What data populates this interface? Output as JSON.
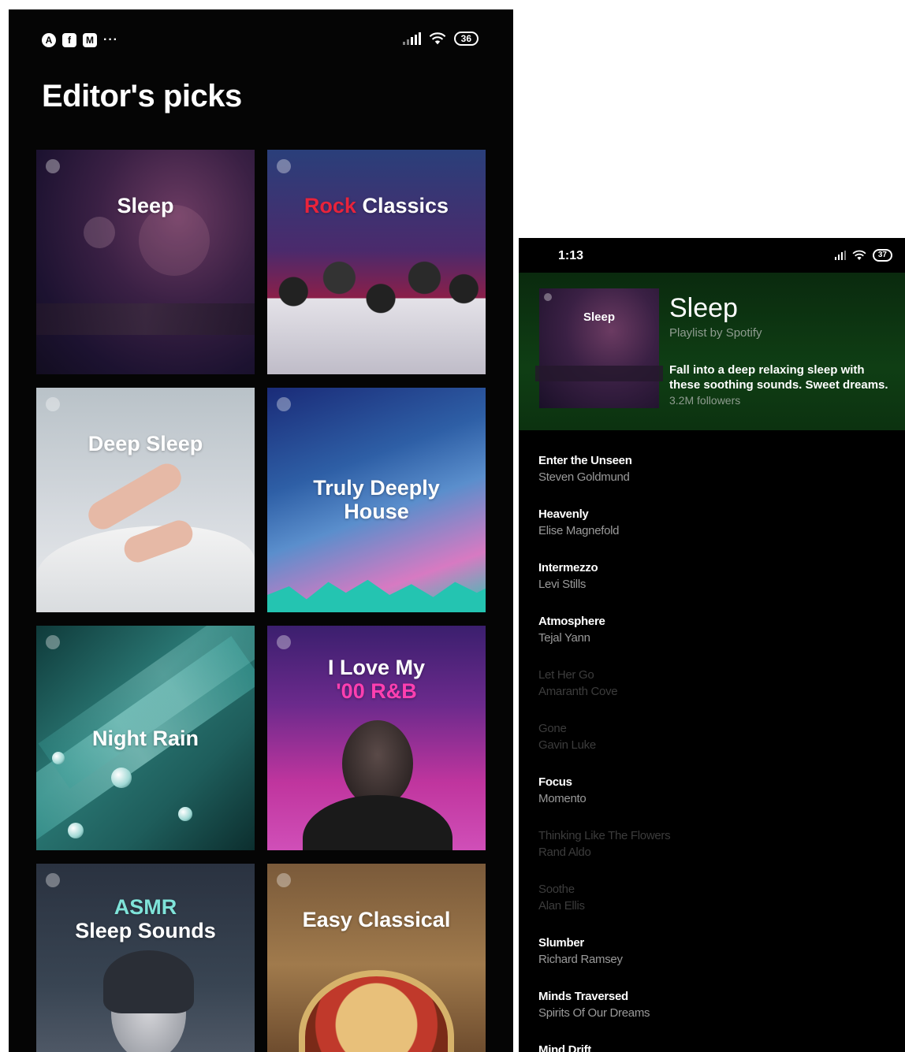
{
  "left_phone": {
    "status": {
      "battery": "36",
      "more": "···"
    },
    "title": "Editor's picks",
    "tiles": [
      {
        "title": "Sleep"
      },
      {
        "title_accent": "Rock",
        "title": "Classics",
        "accent_color": "#e8233b"
      },
      {
        "title": "Deep Sleep"
      },
      {
        "title": "Truly Deeply House"
      },
      {
        "title": "Night Rain"
      },
      {
        "title": "I Love My",
        "title_line2": "'00 R&B",
        "accent_color": "#ff3fb0"
      },
      {
        "title_accent": "ASMR",
        "title": "Sleep Sounds",
        "accent_color": "#7fe3d9"
      },
      {
        "title": "Easy Classical"
      }
    ]
  },
  "right_phone": {
    "status": {
      "time": "1:13",
      "battery": "37"
    },
    "playlist": {
      "cover_label": "Sleep",
      "title": "Sleep",
      "subtitle": "Playlist by Spotify",
      "description": "Fall into a deep relaxing sleep with these soothing sounds. Sweet dreams.",
      "followers": "3.2M followers",
      "header_color": "#0f3e14"
    },
    "tracks": [
      {
        "name": "Enter the Unseen",
        "artist": "Steven Goldmund",
        "dim": false
      },
      {
        "name": "Heavenly",
        "artist": "Elise Magnefold",
        "dim": false
      },
      {
        "name": "Intermezzo",
        "artist": "Levi Stills",
        "dim": false
      },
      {
        "name": "Atmosphere",
        "artist": "Tejal Yann",
        "dim": false
      },
      {
        "name": "Let Her Go",
        "artist": "Amaranth Cove",
        "dim": true
      },
      {
        "name": "Gone",
        "artist": "Gavin Luke",
        "dim": true
      },
      {
        "name": "Focus",
        "artist": "Momento",
        "dim": false
      },
      {
        "name": "Thinking Like The Flowers",
        "artist": "Rand Aldo",
        "dim": true
      },
      {
        "name": "Soothe",
        "artist": "Alan Ellis",
        "dim": true
      },
      {
        "name": "Slumber",
        "artist": "Richard Ramsey",
        "dim": false
      },
      {
        "name": "Minds Traversed",
        "artist": "Spirits Of Our Dreams",
        "dim": false
      },
      {
        "name": "Mind Drift",
        "artist": "",
        "dim": false
      }
    ]
  }
}
